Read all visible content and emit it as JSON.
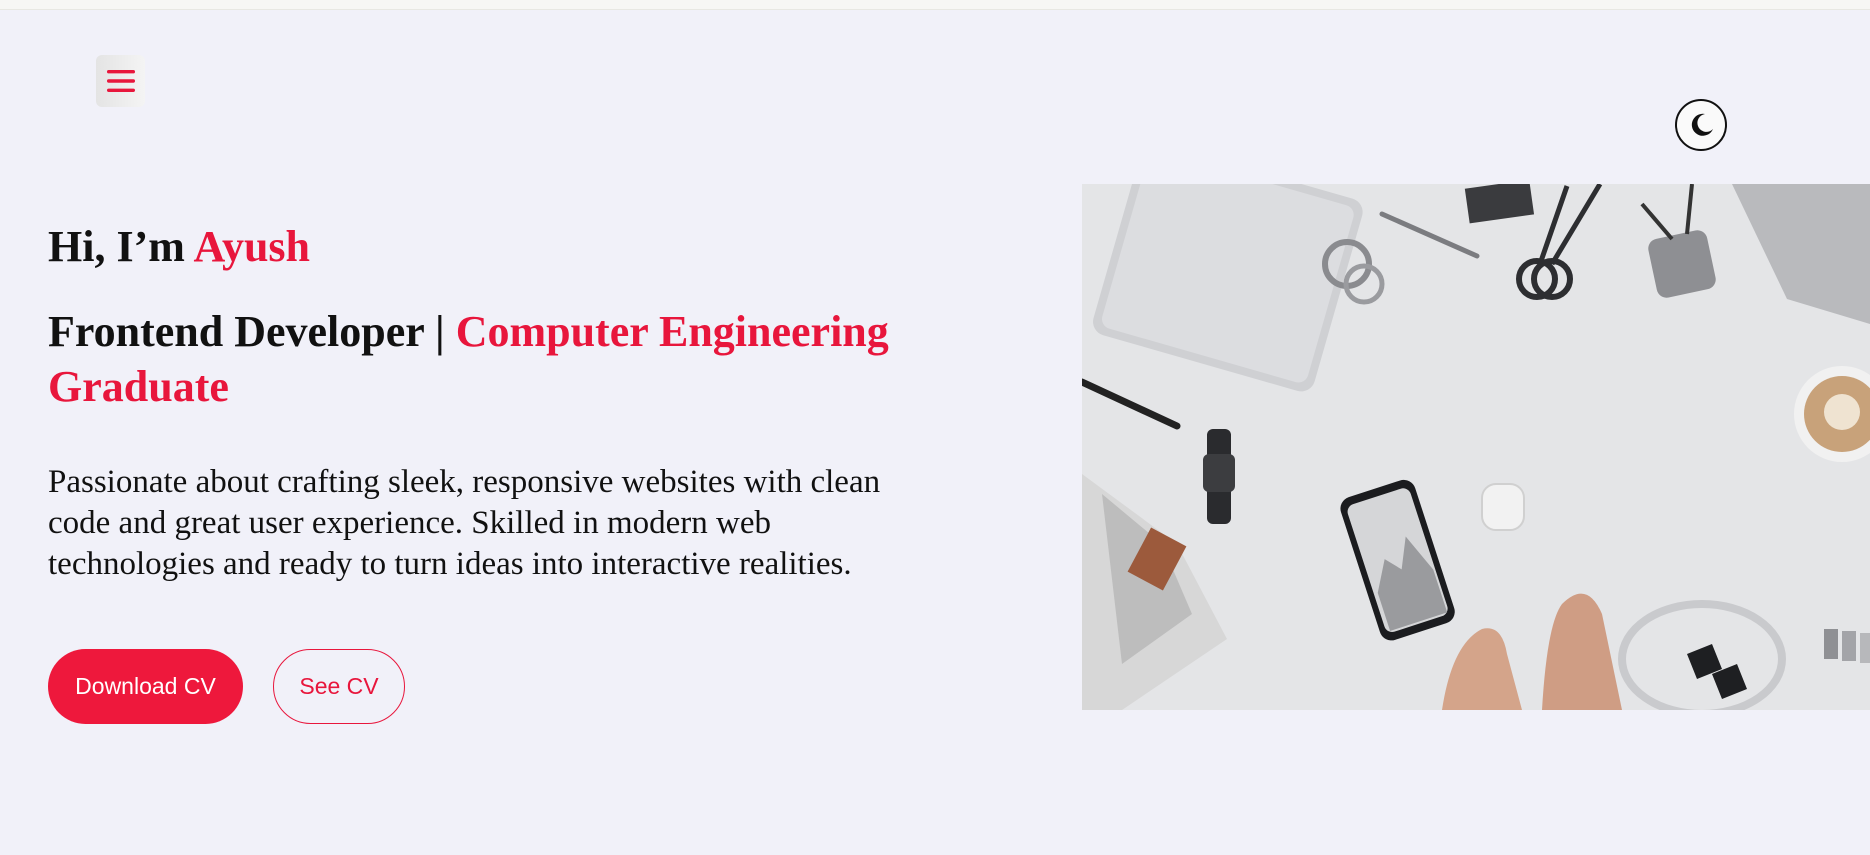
{
  "header": {
    "menu_icon": "hamburger-menu-icon",
    "theme_toggle_icon": "moon-icon"
  },
  "hero": {
    "greeting_prefix": "Hi, I’m ",
    "greeting_name": "Ayush",
    "role_primary": "Frontend Developer | ",
    "role_accent": "Computer Engineering Graduate",
    "bio": "Passionate about crafting sleek, responsive websites with clean code and great user experience. Skilled in modern web technologies and ready to turn ideas into interactive realities.",
    "download_cv_label": "Download CV",
    "see_cv_label": "See CV",
    "image_description_icon": "workspace-photo"
  },
  "colors": {
    "accent": "#e8163c",
    "background": "#f1f1f9",
    "text": "#111111"
  }
}
